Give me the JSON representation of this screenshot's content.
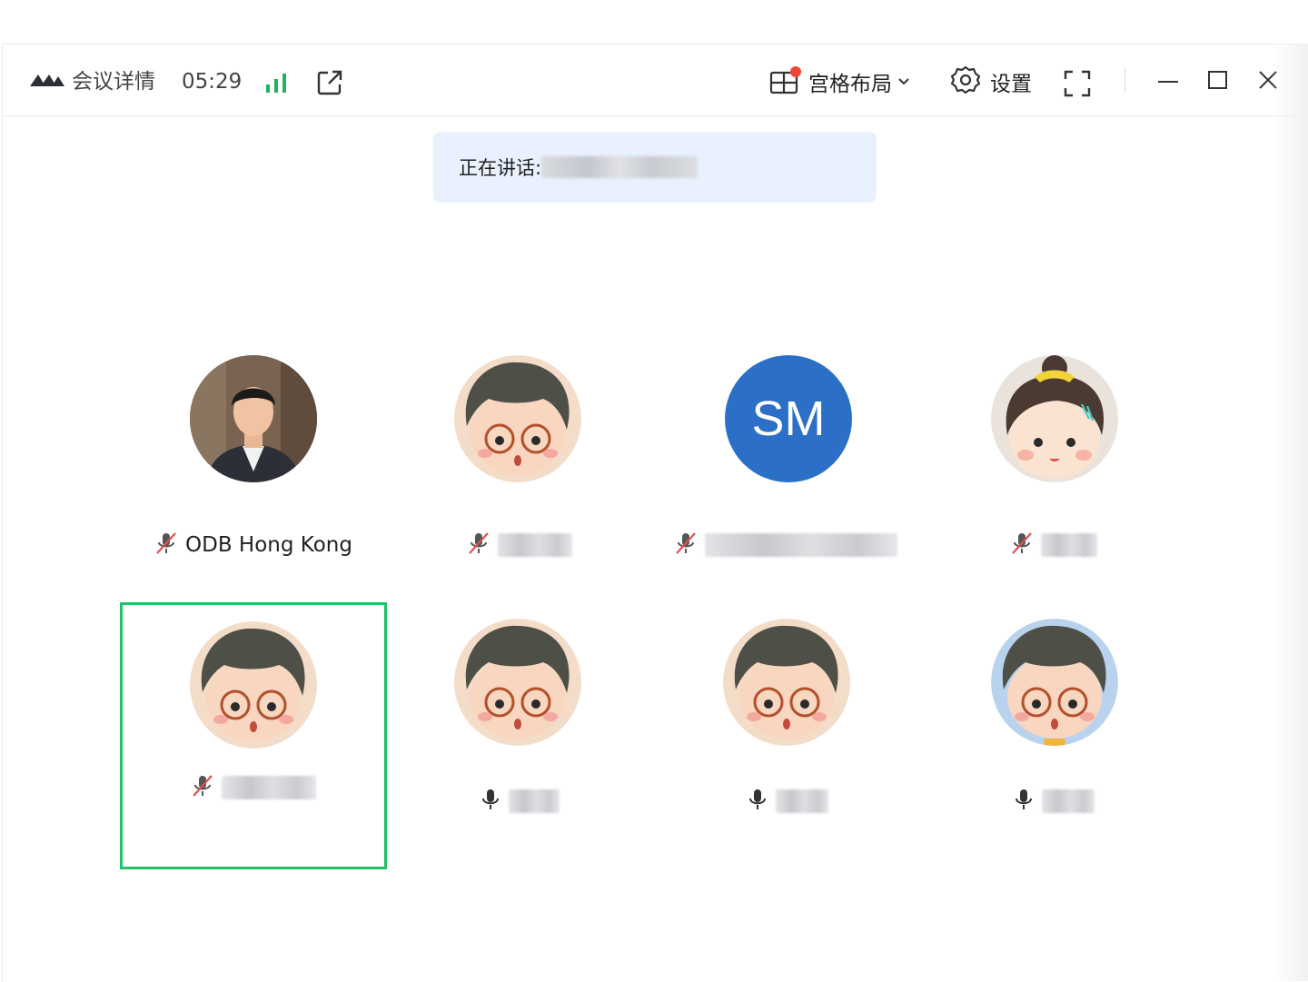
{
  "toolbar": {
    "meeting_details_label": "会议详情",
    "timer": "05:29",
    "layout_label": "宫格布局",
    "settings_label": "设置",
    "icons": {
      "logo": "tencent-meeting-logo-icon",
      "signal": "signal-strength-icon",
      "share": "external-link-icon",
      "layout": "grid-layout-icon",
      "settings": "gear-icon",
      "fullscreen": "fullscreen-icon",
      "minimize": "minimize-icon",
      "maximize": "maximize-icon",
      "close": "close-icon"
    },
    "layout_notification_dot_color": "#f04438"
  },
  "speaking": {
    "label": "正在讲话:"
  },
  "participants": [
    {
      "name": "ODB Hong Kong",
      "avatar": "photo",
      "mic": "muted"
    },
    {
      "name": "",
      "avatar": "cartoon-boy",
      "mic": "muted"
    },
    {
      "name": "",
      "avatar": "initials",
      "initials": "SM",
      "mic": "muted"
    },
    {
      "name": "",
      "avatar": "cartoon-girl",
      "mic": "muted"
    },
    {
      "name": "",
      "avatar": "cartoon-boy",
      "mic": "muted",
      "selected": true
    },
    {
      "name": "",
      "avatar": "cartoon-boy",
      "mic": "on"
    },
    {
      "name": "",
      "avatar": "cartoon-boy",
      "mic": "on"
    },
    {
      "name": "",
      "avatar": "cartoon-boy",
      "mic": "on"
    }
  ],
  "colors": {
    "selected_border": "#22c06a",
    "signal": "#22b35e",
    "speaking_bg": "#eaf1fe",
    "initials_avatar_bg": "#2b6fc6",
    "muted_icon": "#e05050"
  }
}
